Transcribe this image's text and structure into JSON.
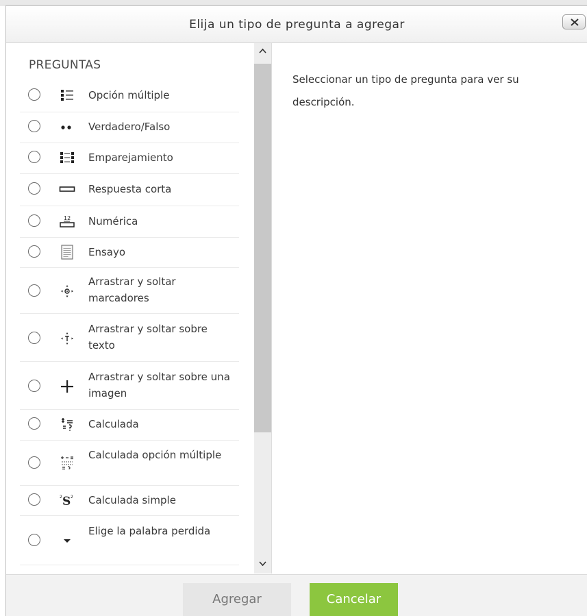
{
  "dialog": {
    "title": "Elija un tipo de pregunta a agregar",
    "close_icon": "close-icon"
  },
  "left": {
    "section_title": "PREGUNTAS",
    "items": [
      {
        "label": "Opción múltiple",
        "icon": "multichoice-icon"
      },
      {
        "label": "Verdadero/Falso",
        "icon": "truefalse-icon"
      },
      {
        "label": "Emparejamiento",
        "icon": "match-icon"
      },
      {
        "label": "Respuesta corta",
        "icon": "shortanswer-icon"
      },
      {
        "label": "Numérica",
        "icon": "numerical-icon"
      },
      {
        "label": "Ensayo",
        "icon": "essay-icon"
      },
      {
        "label": "Arrastrar y soltar marcadores",
        "icon": "ddmarker-icon"
      },
      {
        "label": "Arrastrar y soltar sobre texto",
        "icon": "ddwtos-icon"
      },
      {
        "label": "Arrastrar y soltar sobre una imagen",
        "icon": "ddimageortext-icon"
      },
      {
        "label": "Calculada",
        "icon": "calculated-icon"
      },
      {
        "label": "Calculada opción múltiple",
        "icon": "calculatedmulti-icon"
      },
      {
        "label": "Calculada simple",
        "icon": "calculatedsimple-icon"
      },
      {
        "label": "Elige la palabra perdida",
        "icon": "gapselect-icon"
      }
    ]
  },
  "right": {
    "description": "Seleccionar un tipo de pregunta para ver su descripción."
  },
  "footer": {
    "add_label": "Agregar",
    "cancel_label": "Cancelar"
  },
  "colors": {
    "cancel_green": "#8cc63f",
    "add_gray": "#e6e6e6"
  }
}
